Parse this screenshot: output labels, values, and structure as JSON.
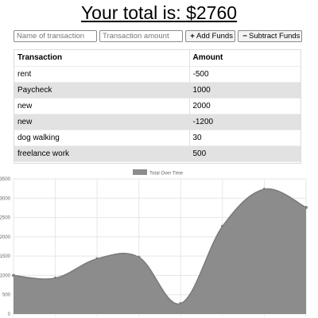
{
  "header": {
    "title": "Your total is: $2760"
  },
  "form": {
    "name_placeholder": "Name of transaction",
    "amount_placeholder": "Transaction amount",
    "add_label": "Add Funds",
    "subtract_label": "Subtract Funds",
    "add_icon": "plus-icon",
    "subtract_icon": "minus-icon"
  },
  "table": {
    "headers": [
      "Transaction",
      "Amount"
    ],
    "rows": [
      [
        "rent",
        "-500"
      ],
      [
        "Paycheck",
        "1000"
      ],
      [
        "new",
        "2000"
      ],
      [
        "new",
        "-1200"
      ],
      [
        "dog walking",
        "30"
      ],
      [
        "freelance work",
        "500"
      ]
    ]
  },
  "chart_data": {
    "type": "area",
    "legend": "Total Over Time",
    "legend_position": "top-center",
    "fill_color": "#8c8c8c",
    "grid": true,
    "ylim": [
      0,
      3500
    ],
    "y_ticks": [
      "0",
      "500",
      "1000",
      "1500",
      "2000",
      "2500",
      "3000",
      "3500"
    ],
    "series": [
      {
        "name": "Total Over Time",
        "values": [
          1000,
          930,
          1430,
          1470,
          270,
          2270,
          3230,
          2760
        ]
      }
    ]
  }
}
